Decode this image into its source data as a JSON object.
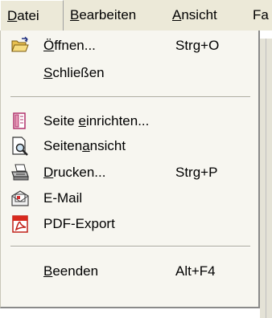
{
  "menubar": {
    "items": [
      {
        "pre": "",
        "key": "D",
        "post": "atei"
      },
      {
        "pre": "",
        "key": "B",
        "post": "earbeiten"
      },
      {
        "pre": "",
        "key": "A",
        "post": "nsicht"
      },
      {
        "pre": "Fa",
        "key": "",
        "post": ""
      }
    ]
  },
  "menu": {
    "items": [
      {
        "pre": "",
        "key": "Ö",
        "post": "ffnen...",
        "shortcut": "Strg+O",
        "icon": "open-folder-icon"
      },
      {
        "pre": "",
        "key": "S",
        "post": "chließen",
        "shortcut": "",
        "icon": ""
      },
      {
        "pre": "Seite ",
        "key": "e",
        "post": "inrichten...",
        "shortcut": "",
        "icon": "page-setup-icon"
      },
      {
        "pre": "Seiten",
        "key": "a",
        "post": "nsicht",
        "shortcut": "",
        "icon": "print-preview-icon"
      },
      {
        "pre": "",
        "key": "D",
        "post": "rucken...",
        "shortcut": "Strg+P",
        "icon": "printer-icon"
      },
      {
        "pre": "E-Mail",
        "key": "",
        "post": "",
        "shortcut": "",
        "icon": "email-icon"
      },
      {
        "pre": "PDF-Export",
        "key": "",
        "post": "",
        "shortcut": "",
        "icon": "pdf-icon"
      },
      {
        "pre": "",
        "key": "B",
        "post": "eenden",
        "shortcut": "Alt+F4",
        "icon": ""
      }
    ]
  }
}
